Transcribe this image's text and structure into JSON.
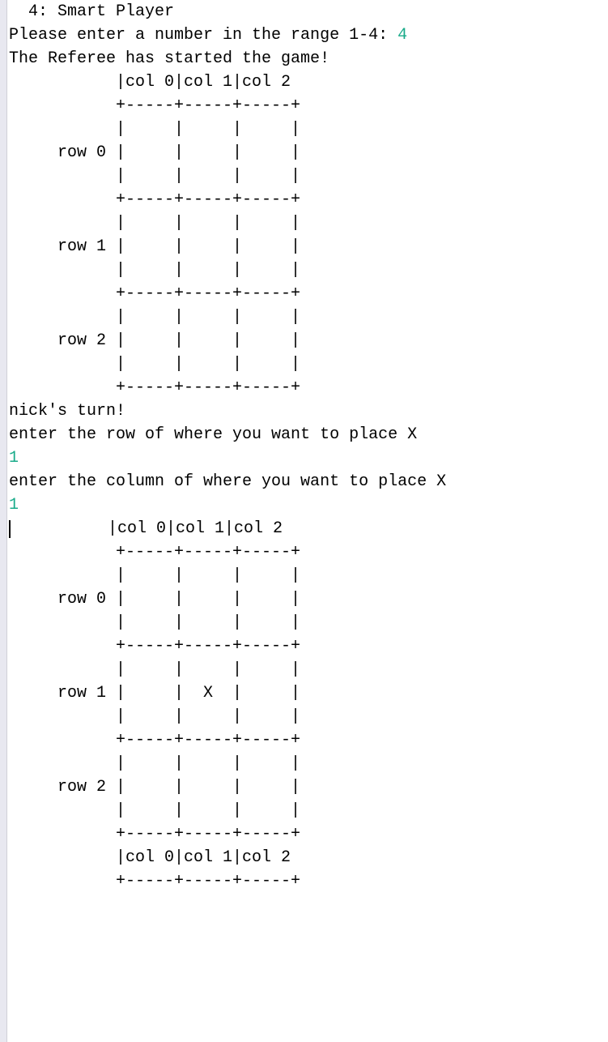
{
  "lines": [
    {
      "segments": [
        {
          "text": "  4: Smart Player"
        }
      ]
    },
    {
      "segments": [
        {
          "text": "Please enter a number in the range 1-4: "
        },
        {
          "text": "4",
          "input": true
        }
      ]
    },
    {
      "segments": [
        {
          "text": "The Referee has started the game!"
        }
      ]
    },
    {
      "segments": [
        {
          "text": "           |col 0|col 1|col 2"
        }
      ]
    },
    {
      "segments": [
        {
          "text": "           +-----+-----+-----+"
        }
      ]
    },
    {
      "segments": [
        {
          "text": "           |     |     |     |"
        }
      ]
    },
    {
      "segments": [
        {
          "text": "     row 0 |     |     |     |"
        }
      ]
    },
    {
      "segments": [
        {
          "text": "           |     |     |     |"
        }
      ]
    },
    {
      "segments": [
        {
          "text": "           +-----+-----+-----+"
        }
      ]
    },
    {
      "segments": [
        {
          "text": "           |     |     |     |"
        }
      ]
    },
    {
      "segments": [
        {
          "text": "     row 1 |     |     |     |"
        }
      ]
    },
    {
      "segments": [
        {
          "text": "           |     |     |     |"
        }
      ]
    },
    {
      "segments": [
        {
          "text": "           +-----+-----+-----+"
        }
      ]
    },
    {
      "segments": [
        {
          "text": "           |     |     |     |"
        }
      ]
    },
    {
      "segments": [
        {
          "text": "     row 2 |     |     |     |"
        }
      ]
    },
    {
      "segments": [
        {
          "text": "           |     |     |     |"
        }
      ]
    },
    {
      "segments": [
        {
          "text": "           +-----+-----+-----+"
        }
      ]
    },
    {
      "segments": [
        {
          "text": "nick's turn!"
        }
      ]
    },
    {
      "segments": [
        {
          "text": "enter the row of where you want to place X"
        }
      ]
    },
    {
      "segments": [
        {
          "text": "1",
          "input": true
        }
      ]
    },
    {
      "segments": [
        {
          "text": "enter the column of where you want to place X"
        }
      ]
    },
    {
      "segments": [
        {
          "text": "1",
          "input": true
        }
      ]
    },
    {
      "segments": [
        {
          "cursor": true
        },
        {
          "text": "          |col 0|col 1|col 2"
        }
      ]
    },
    {
      "segments": [
        {
          "text": "           +-----+-----+-----+"
        }
      ]
    },
    {
      "segments": [
        {
          "text": "           |     |     |     |"
        }
      ]
    },
    {
      "segments": [
        {
          "text": "     row 0 |     |     |     |"
        }
      ]
    },
    {
      "segments": [
        {
          "text": "           |     |     |     |"
        }
      ]
    },
    {
      "segments": [
        {
          "text": "           +-----+-----+-----+"
        }
      ]
    },
    {
      "segments": [
        {
          "text": "           |     |     |     |"
        }
      ]
    },
    {
      "segments": [
        {
          "text": "     row 1 |     |  X  |     |"
        }
      ]
    },
    {
      "segments": [
        {
          "text": "           |     |     |     |"
        }
      ]
    },
    {
      "segments": [
        {
          "text": "           +-----+-----+-----+"
        }
      ]
    },
    {
      "segments": [
        {
          "text": "           |     |     |     |"
        }
      ]
    },
    {
      "segments": [
        {
          "text": "     row 2 |     |     |     |"
        }
      ]
    },
    {
      "segments": [
        {
          "text": "           |     |     |     |"
        }
      ]
    },
    {
      "segments": [
        {
          "text": "           +-----+-----+-----+"
        }
      ]
    },
    {
      "segments": [
        {
          "text": "           |col 0|col 1|col 2"
        }
      ]
    },
    {
      "segments": [
        {
          "text": "           +-----+-----+-----+"
        }
      ]
    }
  ]
}
